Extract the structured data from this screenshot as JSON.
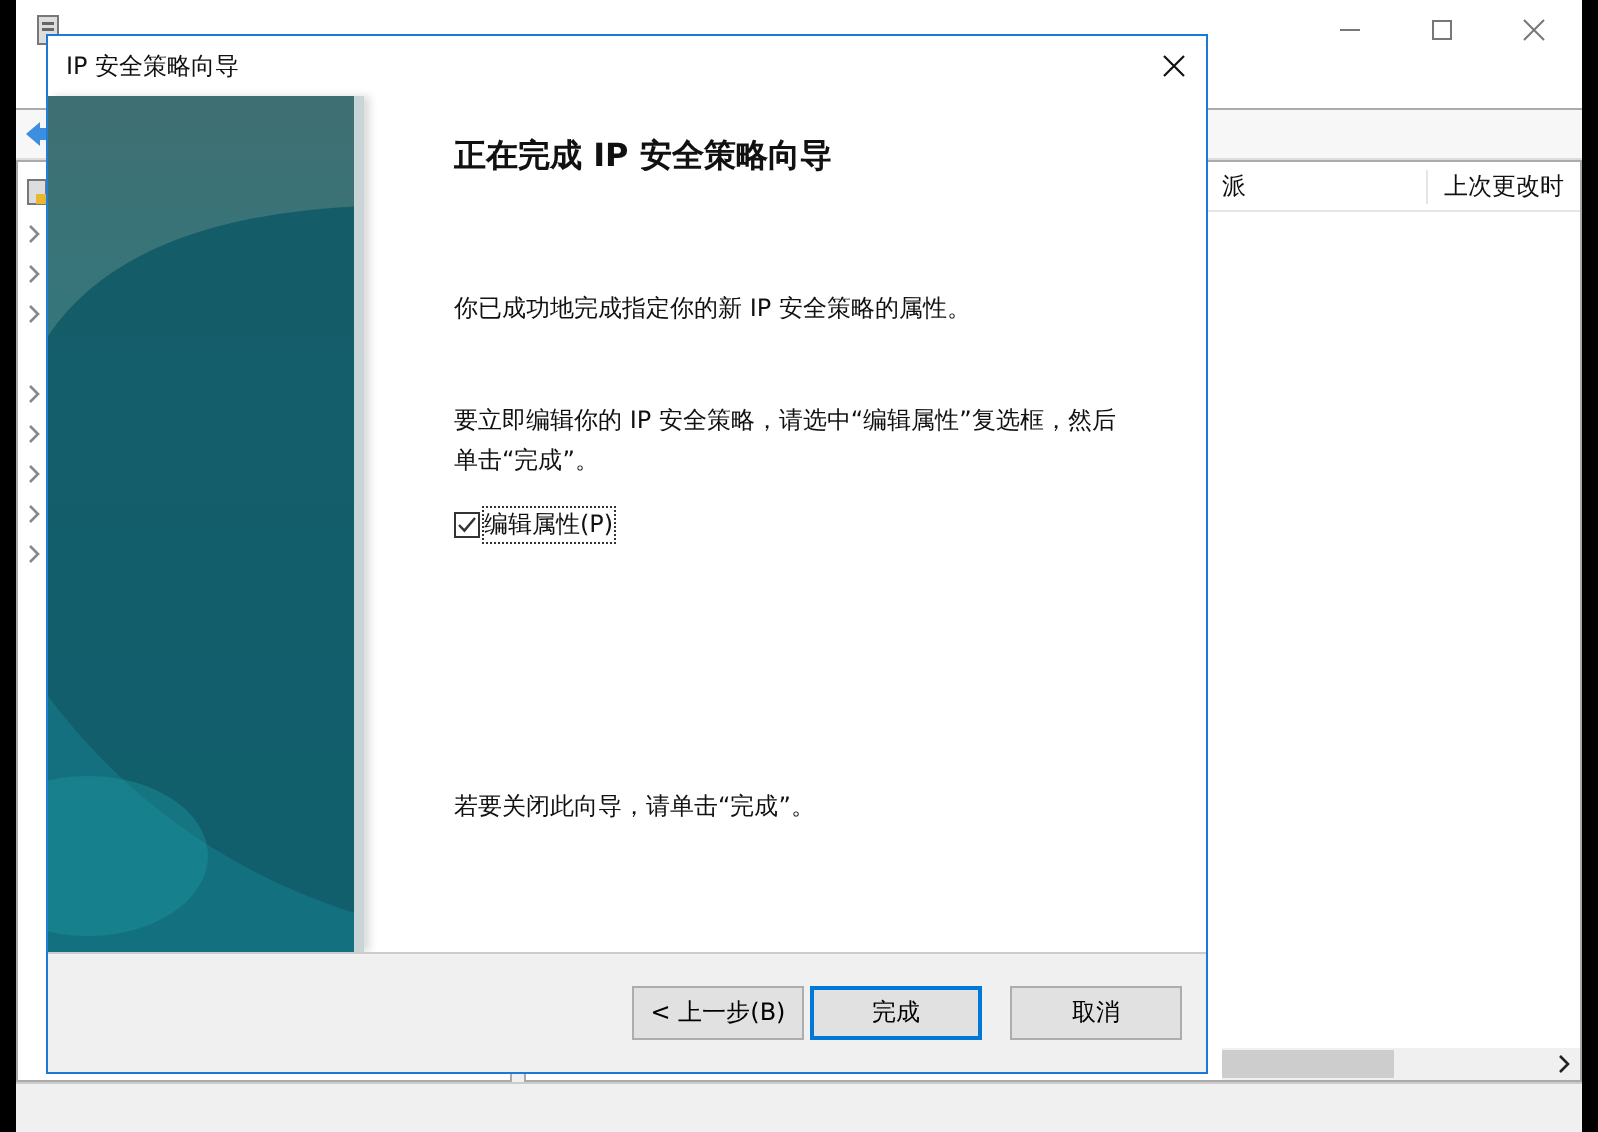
{
  "background_window": {
    "columns": [
      "派",
      "上次更改时"
    ]
  },
  "dialog": {
    "title": "IP 安全策略向导",
    "heading": "正在完成 IP 安全策略向导",
    "paragraphs": [
      "你已成功地完成指定你的新 IP 安全策略的属性。",
      "要立即编辑你的 IP 安全策略，请选中“编辑属性”复选框，然后单击“完成”。"
    ],
    "checkbox": {
      "label": "编辑属性(P)",
      "checked": true
    },
    "closing": "若要关闭此向导，请单击“完成”。",
    "buttons": [
      {
        "label": "< 上一步(B)",
        "default": false
      },
      {
        "label": "完成",
        "default": true
      },
      {
        "label": "取消",
        "default": false
      }
    ]
  }
}
